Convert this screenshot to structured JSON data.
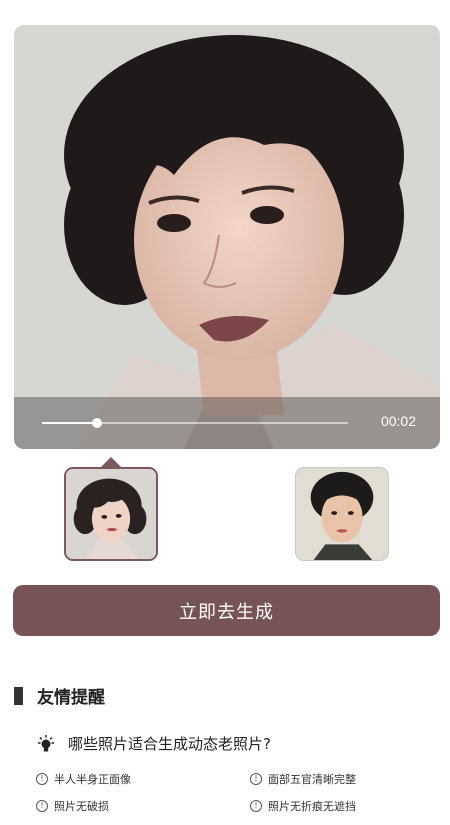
{
  "player": {
    "time": "00:02",
    "progress": 0.18
  },
  "thumbnails": [
    {
      "name": "portrait-1",
      "selected": true
    },
    {
      "name": "portrait-2",
      "selected": false
    }
  ],
  "actions": {
    "generate_label": "立即去生成"
  },
  "tips": {
    "section_title": "友情提醒",
    "question": "哪些照片适合生成动态老照片?",
    "items": [
      "半人半身正面像",
      "面部五官清晰完整",
      "照片无破损",
      "照片无折痕无遮挡"
    ]
  },
  "colors": {
    "accent": "#765355",
    "selected_border": "#7a5a5c"
  },
  "icons": {
    "question": "lightbulb-icon",
    "tip": "info-circle-icon"
  }
}
